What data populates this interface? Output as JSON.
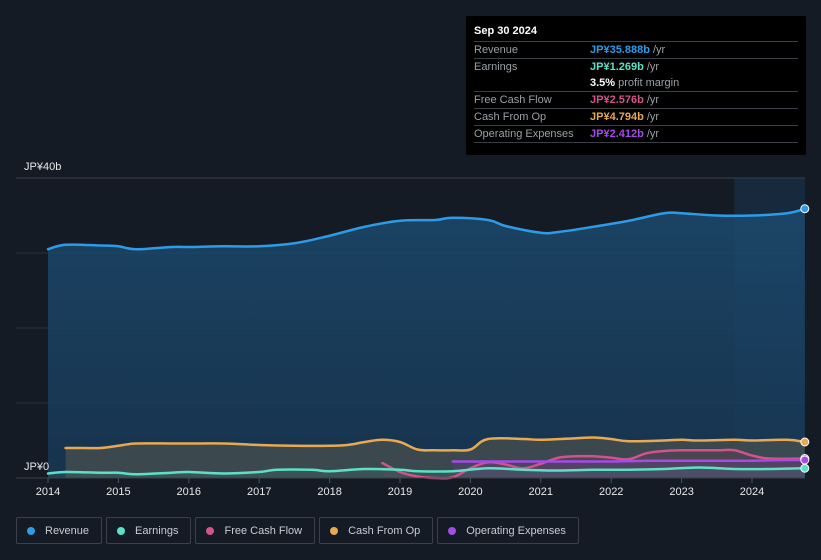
{
  "tooltip": {
    "date": "Sep 30 2024",
    "rows": [
      {
        "label": "Revenue",
        "value": "JP¥35.888b",
        "unit": "/yr",
        "color": "#2d9be5"
      },
      {
        "label": "Earnings",
        "value": "JP¥1.269b",
        "unit": "/yr",
        "color": "#5ce0c6"
      },
      {
        "label": "",
        "value": "3.5%",
        "unit": "profit margin",
        "color": "#ffffff"
      },
      {
        "label": "Free Cash Flow",
        "value": "JP¥2.576b",
        "unit": "/yr",
        "color": "#d1538a"
      },
      {
        "label": "Cash From Op",
        "value": "JP¥4.794b",
        "unit": "/yr",
        "color": "#e8a951"
      },
      {
        "label": "Operating Expenses",
        "value": "JP¥2.412b",
        "unit": "/yr",
        "color": "#a54be8"
      }
    ]
  },
  "legend": [
    {
      "label": "Revenue",
      "color": "#2d9be5"
    },
    {
      "label": "Earnings",
      "color": "#5ce0c6"
    },
    {
      "label": "Free Cash Flow",
      "color": "#d1538a"
    },
    {
      "label": "Cash From Op",
      "color": "#e8a951"
    },
    {
      "label": "Operating Expenses",
      "color": "#a54be8"
    }
  ],
  "chart_data": {
    "type": "area",
    "title": "",
    "xlabel": "",
    "ylabel": "",
    "y_tick_labels": [
      "JP¥0",
      "JP¥40b"
    ],
    "ylim": [
      0,
      40
    ],
    "xlim": [
      2014,
      2024.75
    ],
    "x_ticks": [
      2014,
      2015,
      2016,
      2017,
      2018,
      2019,
      2020,
      2021,
      2022,
      2023,
      2024
    ],
    "x_tick_labels": [
      "2014",
      "2015",
      "2016",
      "2017",
      "2018",
      "2019",
      "2020",
      "2021",
      "2022",
      "2023",
      "2024"
    ],
    "grid": true,
    "highlight_range": [
      2023.75,
      2024.75
    ],
    "unit": "JP¥ billions",
    "series": [
      {
        "name": "Revenue",
        "color": "#2d9be5",
        "x": [
          2014.0,
          2014.25,
          2014.75,
          2015.0,
          2015.25,
          2015.75,
          2016.0,
          2016.5,
          2017.0,
          2017.5,
          2018.0,
          2018.5,
          2019.0,
          2019.5,
          2019.75,
          2020.25,
          2020.5,
          2021.0,
          2021.25,
          2021.75,
          2022.25,
          2022.75,
          2023.0,
          2023.5,
          2024.0,
          2024.5,
          2024.75
        ],
        "values": [
          30.5,
          31.1,
          31.0,
          30.9,
          30.5,
          30.8,
          30.8,
          30.9,
          30.9,
          31.3,
          32.3,
          33.5,
          34.3,
          34.4,
          34.7,
          34.4,
          33.6,
          32.7,
          32.8,
          33.5,
          34.3,
          35.3,
          35.3,
          35.0,
          35.0,
          35.3,
          35.9
        ]
      },
      {
        "name": "Earnings",
        "color": "#5ce0c6",
        "x": [
          2014.0,
          2014.25,
          2014.75,
          2015.0,
          2015.25,
          2015.75,
          2016.0,
          2016.5,
          2017.0,
          2017.25,
          2017.75,
          2018.0,
          2018.5,
          2019.0,
          2019.25,
          2019.75,
          2020.25,
          2020.75,
          2021.25,
          2021.75,
          2022.25,
          2022.75,
          2023.25,
          2023.75,
          2024.25,
          2024.75
        ],
        "values": [
          0.6,
          0.8,
          0.7,
          0.7,
          0.5,
          0.7,
          0.8,
          0.6,
          0.8,
          1.1,
          1.1,
          0.9,
          1.2,
          1.1,
          0.9,
          0.9,
          1.3,
          1.1,
          1.0,
          1.1,
          1.1,
          1.2,
          1.4,
          1.2,
          1.2,
          1.3
        ]
      },
      {
        "name": "Free Cash Flow",
        "color": "#d1538a",
        "x": [
          2018.75,
          2019.0,
          2019.25,
          2019.5,
          2019.75,
          2020.0,
          2020.25,
          2020.5,
          2020.75,
          2021.0,
          2021.25,
          2021.5,
          2021.75,
          2022.0,
          2022.25,
          2022.5,
          2022.75,
          2023.0,
          2023.5,
          2023.75,
          2024.0,
          2024.25,
          2024.75
        ],
        "values": [
          2.0,
          0.8,
          0.2,
          0.0,
          0.1,
          1.3,
          2.1,
          1.8,
          1.3,
          1.9,
          2.7,
          2.9,
          2.9,
          2.7,
          2.5,
          3.3,
          3.6,
          3.7,
          3.7,
          3.7,
          3.0,
          2.6,
          2.6
        ]
      },
      {
        "name": "Cash From Op",
        "color": "#e8a951",
        "x": [
          2014.25,
          2014.5,
          2014.75,
          2015.0,
          2015.25,
          2015.75,
          2016.0,
          2016.5,
          2017.0,
          2017.5,
          2018.0,
          2018.25,
          2018.5,
          2018.75,
          2019.0,
          2019.25,
          2019.5,
          2019.75,
          2020.0,
          2020.25,
          2020.75,
          2021.0,
          2021.5,
          2021.75,
          2022.0,
          2022.25,
          2022.75,
          2023.0,
          2023.25,
          2023.75,
          2024.0,
          2024.5,
          2024.75
        ],
        "values": [
          4.0,
          4.0,
          4.0,
          4.3,
          4.6,
          4.6,
          4.6,
          4.6,
          4.4,
          4.3,
          4.3,
          4.4,
          4.8,
          5.1,
          4.8,
          3.8,
          3.7,
          3.7,
          3.8,
          5.2,
          5.2,
          5.1,
          5.3,
          5.4,
          5.2,
          4.9,
          5.0,
          5.1,
          5.0,
          5.1,
          5.0,
          5.1,
          4.8
        ]
      },
      {
        "name": "Operating Expenses",
        "color": "#a54be8",
        "x": [
          2019.75,
          2020.5,
          2021.0,
          2021.5,
          2022.0,
          2022.5,
          2023.0,
          2023.5,
          2024.0,
          2024.5,
          2024.75
        ],
        "values": [
          2.2,
          2.2,
          2.2,
          2.2,
          2.2,
          2.3,
          2.3,
          2.3,
          2.3,
          2.4,
          2.4
        ]
      }
    ]
  }
}
